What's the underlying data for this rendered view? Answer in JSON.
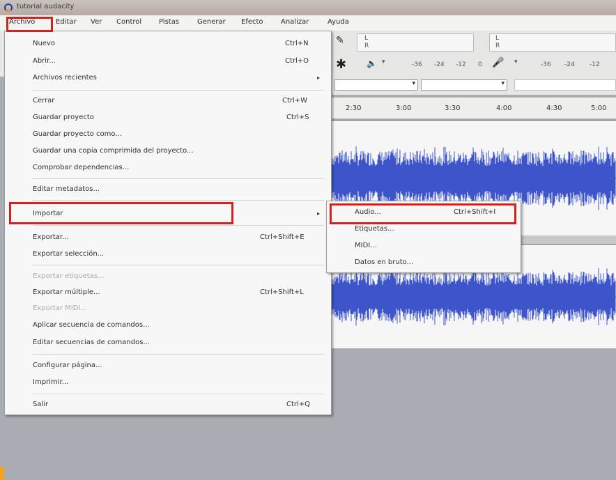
{
  "window": {
    "title": "tutorial audacity"
  },
  "menubar": [
    "Archivo",
    "Editar",
    "Ver",
    "Control",
    "Pistas",
    "Generar",
    "Efecto",
    "Analizar",
    "Ayuda"
  ],
  "toolbar": {
    "meter_play": {
      "left": "L",
      "right": "R"
    },
    "meter_rec": {
      "left": "L",
      "right": "R"
    },
    "play_ticks": [
      "-36",
      "-24",
      "-12",
      "0"
    ],
    "rec_ticks": [
      "-36",
      "-24",
      "-12"
    ]
  },
  "timeline": [
    "2:30",
    "3:00",
    "3:30",
    "4:00",
    "4:30",
    "5:00"
  ],
  "archivo_menu": [
    {
      "label": "Nuevo",
      "shortcut": "Ctrl+N"
    },
    {
      "label": "Abrir...",
      "shortcut": "Ctrl+O"
    },
    {
      "label": "Archivos recientes",
      "shortcut": ""
    },
    {
      "label": "Cerrar",
      "shortcut": "Ctrl+W"
    },
    {
      "label": "Guardar proyecto",
      "shortcut": "Ctrl+S"
    },
    {
      "label": "Guardar proyecto como...",
      "shortcut": ""
    },
    {
      "label": "Guardar una copia comprimida del proyecto...",
      "shortcut": ""
    },
    {
      "label": "Comprobar dependencias...",
      "shortcut": ""
    },
    {
      "label": "Editar metadatos...",
      "shortcut": ""
    },
    {
      "label": "Importar",
      "shortcut": ""
    },
    {
      "label": "Exportar...",
      "shortcut": "Ctrl+Shift+E"
    },
    {
      "label": "Exportar selección...",
      "shortcut": ""
    },
    {
      "label": "Exportar etiquetas...",
      "shortcut": ""
    },
    {
      "label": "Exportar múltiple...",
      "shortcut": "Ctrl+Shift+L"
    },
    {
      "label": "Exportar MIDI...",
      "shortcut": ""
    },
    {
      "label": "Aplicar secuencia de comandos...",
      "shortcut": ""
    },
    {
      "label": "Editar secuencias de comandos...",
      "shortcut": ""
    },
    {
      "label": "Configurar página...",
      "shortcut": ""
    },
    {
      "label": "Imprimir...",
      "shortcut": ""
    },
    {
      "label": "Salir",
      "shortcut": "Ctrl+Q"
    }
  ],
  "importar_submenu": [
    {
      "label": "Audio...",
      "shortcut": "Ctrl+Shift+I"
    },
    {
      "label": "Etiquetas...",
      "shortcut": ""
    },
    {
      "label": "MIDI...",
      "shortcut": ""
    },
    {
      "label": "Datos en bruto...",
      "shortcut": ""
    }
  ],
  "colors": {
    "highlight": "#d42020",
    "waveform": "#3e55c9"
  }
}
